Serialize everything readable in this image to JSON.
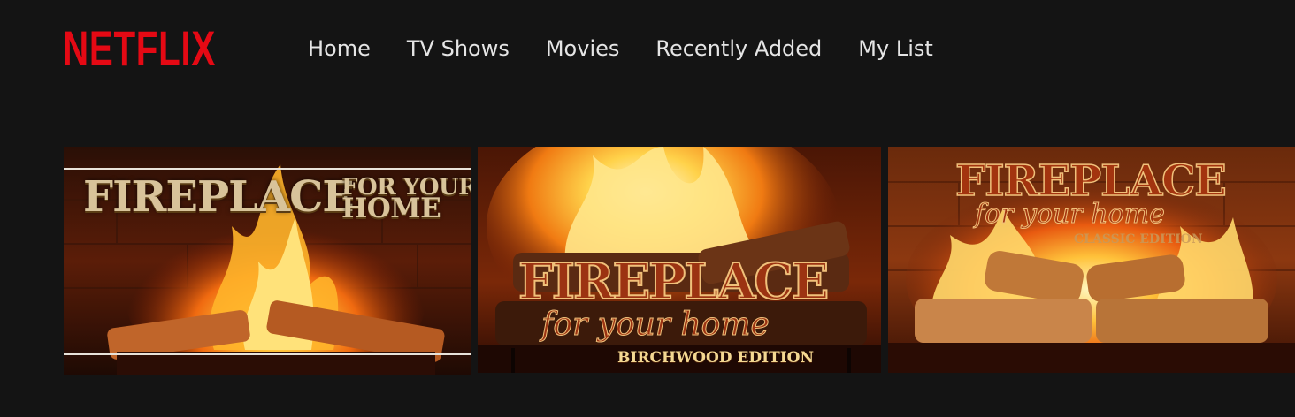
{
  "header": {
    "logo": "NETFLIX",
    "nav": [
      {
        "label": "Home"
      },
      {
        "label": "TV Shows"
      },
      {
        "label": "Movies"
      },
      {
        "label": "Recently Added"
      },
      {
        "label": "My List"
      }
    ]
  },
  "tiles": [
    {
      "title_main": "FIREPLACE",
      "title_small_1": "FOR YOUR",
      "title_small_2": "HOME"
    },
    {
      "title_main": "FIREPLACE",
      "title_script": "for your home",
      "edition": "BIRCHWOOD EDITION"
    },
    {
      "title_main": "FIREPLACE",
      "title_script": "for your home",
      "edition": "CLASSIC EDITION"
    }
  ],
  "colors": {
    "background": "#141414",
    "brand_red": "#e50914",
    "nav_text": "#e5e5e5"
  }
}
